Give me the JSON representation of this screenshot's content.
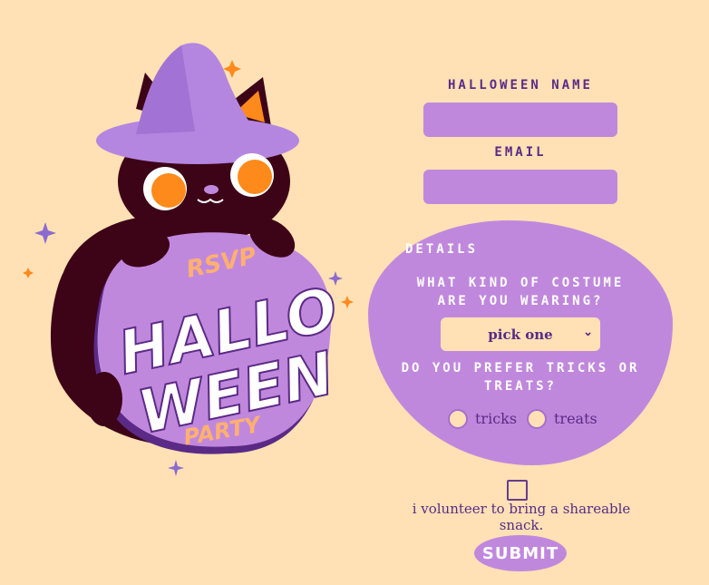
{
  "illustration": {
    "rsvp": "RSVP",
    "title_line1": "HALLO",
    "title_line2": "WEEN",
    "party": "PARTY"
  },
  "form": {
    "name_label": "HALLOWEEN NAME",
    "name_value": "",
    "email_label": "EMAIL",
    "email_value": "",
    "details_label": "DETAILS",
    "costume_question_line1": "WHAT KIND OF COSTUME",
    "costume_question_line2": "ARE YOU WEARING?",
    "costume_select_value": "pick one",
    "tricks_question_line1": "DO YOU PREFER TRICKS OR",
    "tricks_question_line2": "TREATS?",
    "option_tricks": "tricks",
    "option_treats": "treats",
    "volunteer_label": "i volunteer to bring a shareable snack.",
    "submit_label": "SUBMIT"
  },
  "colors": {
    "background": "#ffe1b5",
    "accent_purple": "#c088dd",
    "text_purple": "#5b2a86",
    "cat_body": "#3d0418",
    "orange": "#ff8a1c"
  }
}
